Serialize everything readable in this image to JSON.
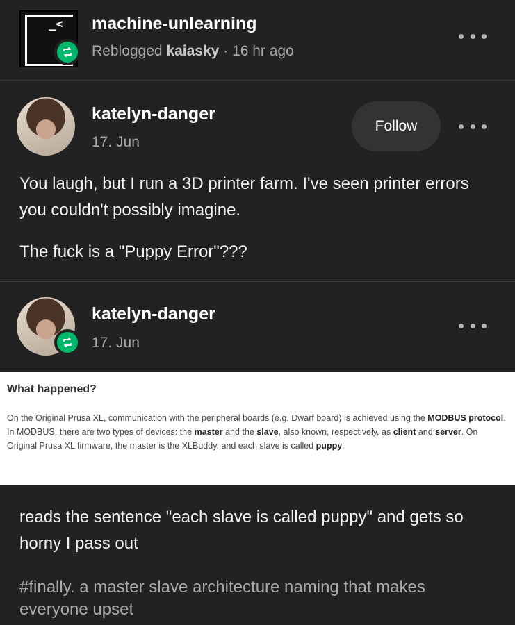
{
  "reblog_header": {
    "blog_name": "machine-unlearning",
    "meta_prefix": "Reblogged",
    "source_blog": "kaiasky",
    "time": "· 16 hr ago",
    "avatar_text": "_<"
  },
  "post1": {
    "username": "katelyn-danger",
    "date": "17. Jun",
    "follow_label": "Follow",
    "paragraphs": [
      "You laugh, but I run a 3D printer farm. I've seen printer errors you couldn't possibly imagine.",
      "The fuck is a \"Puppy Error\"???"
    ]
  },
  "post2": {
    "username": "katelyn-danger",
    "date": "17. Jun",
    "doc": {
      "title": "What happened?",
      "s1": "On the Original Prusa XL, communication with the peripheral boards (e.g. Dwarf board) is achieved using the",
      "modbus": "MODBUS protocol",
      "s2": ". In MODBUS, there are two types of devices: the",
      "master": "master",
      "s3": "and the",
      "slave": "slave",
      "s4": ", also known, respectively, as",
      "client": "client",
      "s5": "and",
      "server": "server",
      "s6": ". On Original Prusa XL firmware, the master is the XLBuddy, and each slave is called",
      "puppy": "puppy",
      "s7": "."
    },
    "text": "reads the sentence \"each slave is called puppy\" and gets so horny I pass out",
    "tags": "#finally. a master slave architecture naming that makes everyone upset"
  },
  "colors": {
    "background": "#222222",
    "reblog_green": "#00b86b",
    "muted_text": "#a8a8a8"
  }
}
